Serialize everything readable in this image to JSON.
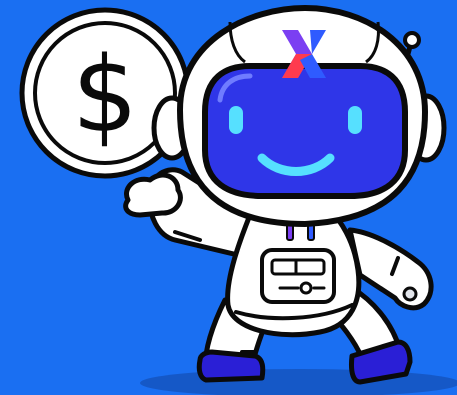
{
  "scene": {
    "coin_symbol": "$",
    "logo_mark": "X",
    "colors": {
      "background": "#1a6ff2",
      "background_shadow": "#1558c7",
      "outline": "#0a0a0a",
      "suit": "#ffffff",
      "suit_shade": "#e3e6ec",
      "visor": "#2f36e8",
      "visor_glow": "#56e0ff",
      "logo_purple": "#7b3ff2",
      "logo_red": "#ff3b4e",
      "logo_blue": "#2f5bff",
      "boot": "#2a1fd6"
    },
    "icons": [
      "coin-icon",
      "astronaut-mascot",
      "logo-icon",
      "antenna-icon",
      "chest-panel-icon"
    ]
  }
}
